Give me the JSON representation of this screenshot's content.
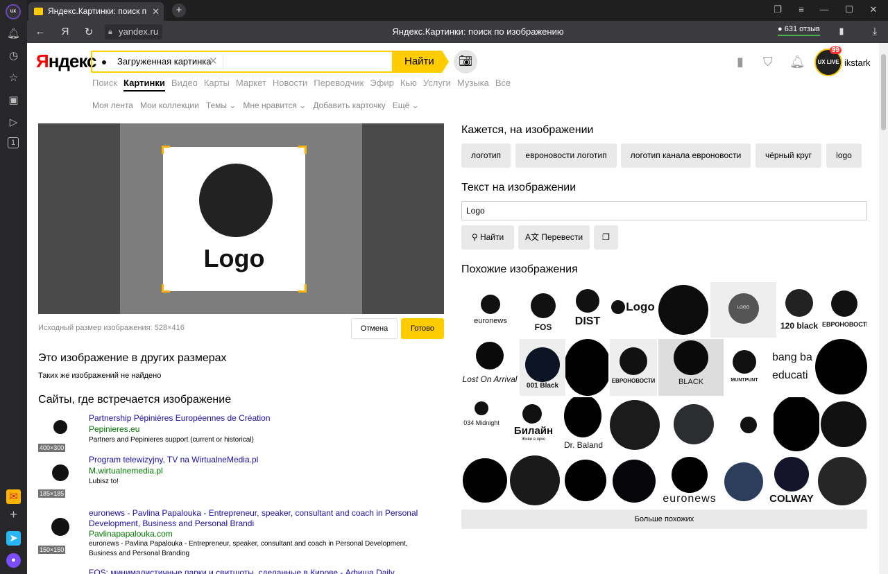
{
  "browser": {
    "tab_title": "Яндекс.Картинки: поиск п",
    "url": "yandex.ru",
    "page_title": "Яндекс.Картинки: поиск по изображению",
    "reviews": "631 отзыв",
    "sidebar_badge": "1"
  },
  "header": {
    "logo_main": "Яндекс",
    "search_chip": "Загруженная картинка",
    "search_button": "Найти",
    "username": "ikstark",
    "avatar_text": "UX LIVE",
    "badge": "99"
  },
  "nav": [
    "Поиск",
    "Картинки",
    "Видео",
    "Карты",
    "Маркет",
    "Новости",
    "Переводчик",
    "Эфир",
    "Кью",
    "Услуги",
    "Музыка",
    "Все"
  ],
  "subnav": [
    "Моя лента",
    "Мои коллекции",
    "Темы ⌄",
    "Мне нравится ⌄",
    "Добавить карточку",
    "Ещё ⌄"
  ],
  "crop": {
    "logo_text": "Logo",
    "info": "Исходный размер изображения: 528×416",
    "cancel": "Отмена",
    "done": "Готово"
  },
  "other_sizes": {
    "title": "Это изображение в других размерах",
    "empty": "Таких же изображений не найдено"
  },
  "sites": {
    "title": "Сайты, где встречается изображение",
    "items": [
      {
        "title": "Partnership Pépinières Européennes de Création",
        "url": "Pepinieres.eu",
        "desc": "Partners and Pepinieres support (current or historical)",
        "size": "400×300"
      },
      {
        "title": "Program telewizyjny, TV na WirtualneMedia.pl",
        "url": "M.wirtualnemedia.pl",
        "desc": "Lubisz to!",
        "size": "185×185"
      },
      {
        "title": "euronews - Pavlina Papalouka - Entrepreneur, speaker, consultant and coach in Personal Development, Business and Personal Brandi",
        "url": "Pavlinapapalouka.com",
        "desc": "euronews - Pavlina Papalouka - Entrepreneur, speaker, consultant and coach in Personal Development, Business and Personal Branding",
        "size": "150×150"
      },
      {
        "title": "FOS: минималистичные парки и свитшоты, сделанные в Кирове - Афиша Daily",
        "url": "",
        "desc": "",
        "size": ""
      }
    ]
  },
  "tags": {
    "title": "Кажется, на изображении",
    "items": [
      "логотип",
      "евроновости логотип",
      "логотип канала евроновости",
      "чёрный круг",
      "logo"
    ]
  },
  "text_on_image": {
    "title": "Текст на изображении",
    "value": "Logo",
    "find": "Найти",
    "translate": "Перевести"
  },
  "similar": {
    "title": "Похожие изображения",
    "labels": [
      "euronews",
      "FOS",
      "DIST",
      "Logo",
      "LOGO",
      "120 black",
      "ЕВРОНОВОСТИ",
      "Lost On Arrival",
      "001 Black",
      "ЕВРОНОВОСТИ",
      "BLACK",
      "MUNTPUNT",
      "bang ba",
      "educati",
      "034 Midnight",
      "Билайн",
      "Живи в ярко",
      "Dr. Balandi",
      "euronews",
      "COLWAY"
    ],
    "more": "Больше похожих"
  }
}
